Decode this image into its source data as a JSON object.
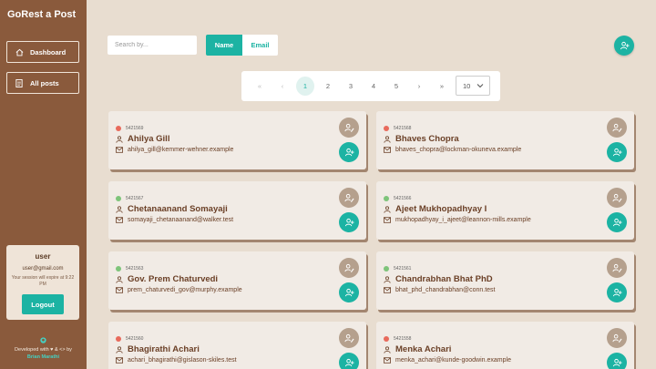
{
  "sidebar": {
    "brand": "GoRest a Post",
    "nav": [
      {
        "label": "Dashboard",
        "icon": "home-icon"
      },
      {
        "label": "All posts",
        "icon": "document-icon"
      }
    ],
    "user": {
      "name": "user",
      "email": "user@gmail.com",
      "expire_text": "Your session will expire at 9:22 PM",
      "logout_label": "Logout"
    },
    "footer": {
      "developed_text": "Developed with ♥ & <> by",
      "author": "Brian Marathi"
    }
  },
  "toolbar": {
    "search_placeholder": "Search by...",
    "filter_options": [
      "Name",
      "Email"
    ],
    "selected_filter": "Name"
  },
  "pagination": {
    "first": "«",
    "prev": "‹",
    "pages": [
      "1",
      "2",
      "3",
      "4",
      "5"
    ],
    "current_page": "1",
    "next": "›",
    "last": "»",
    "per_page": "10"
  },
  "colors": {
    "accent": "#1cb3a3",
    "sidebar": "#8a5a3c",
    "background": "#e8ddd0",
    "status_active": "#7ec47a",
    "status_inactive": "#e86a5c"
  },
  "users": [
    {
      "id": "5421569",
      "name": "Ahilya Gill",
      "email": "ahilya_gill@kemmer-wehner.example",
      "status": "inactive"
    },
    {
      "id": "5421568",
      "name": "Bhaves Chopra",
      "email": "bhaves_chopra@lockman-okuneva.example",
      "status": "inactive"
    },
    {
      "id": "5421567",
      "name": "Chetanaanand Somayaji",
      "email": "somayaji_chetanaanand@walker.test",
      "status": "active"
    },
    {
      "id": "5421566",
      "name": "Ajeet Mukhopadhyay I",
      "email": "mukhopadhyay_i_ajeet@leannon-mills.example",
      "status": "active"
    },
    {
      "id": "5421563",
      "name": "Gov. Prem Chaturvedi",
      "email": "prem_chaturvedi_gov@murphy.example",
      "status": "active"
    },
    {
      "id": "5421561",
      "name": "Chandrabhan Bhat PhD",
      "email": "bhat_phd_chandrabhan@conn.test",
      "status": "active"
    },
    {
      "id": "5421560",
      "name": "Bhagirathi Achari",
      "email": "achari_bhagirathi@gislason-skiles.test",
      "status": "inactive"
    },
    {
      "id": "5421558",
      "name": "Menka Achari",
      "email": "menka_achari@kunde-goodwin.example",
      "status": "inactive"
    }
  ]
}
